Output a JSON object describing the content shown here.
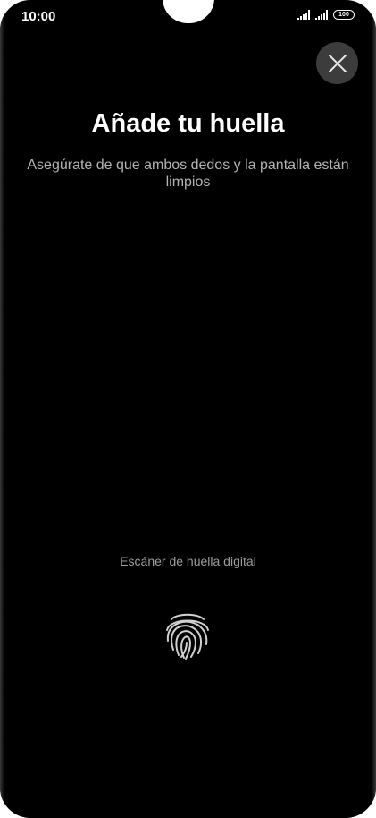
{
  "status_bar": {
    "time": "10:00",
    "battery": "100"
  },
  "header": {
    "title": "Añade tu huella",
    "subtitle": "Asegúrate de que ambos dedos y la pantalla están limpios"
  },
  "scanner": {
    "label": "Escáner de huella digital",
    "icon": "fingerprint-icon"
  },
  "close_button": {
    "icon": "close-icon"
  },
  "colors": {
    "background": "#000000",
    "title": "#ffffff",
    "subtitle": "#b3b3b3",
    "scanner_label": "#9c9c9c",
    "close_button_bg": "#3c3c3c"
  }
}
